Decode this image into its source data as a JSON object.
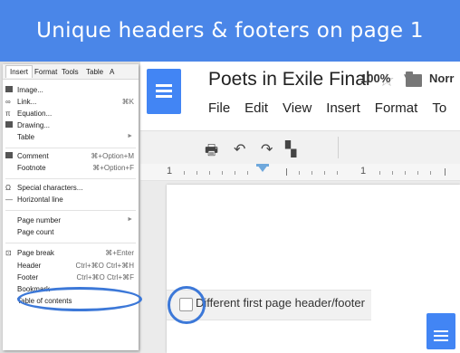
{
  "banner": {
    "title": "Unique headers & footers on page 1"
  },
  "docs": {
    "title": "Poets in Exile Final",
    "menubar": [
      "File",
      "Edit",
      "View",
      "Insert",
      "Format",
      "To"
    ],
    "toolbar": {
      "zoom": "100%",
      "font": "Norr"
    },
    "ruler": {
      "labels": [
        "1",
        "1"
      ]
    },
    "page": {
      "header_option_label": "Different first page header/footer"
    }
  },
  "menu": {
    "tabs": [
      "Insert",
      "Format",
      "Tools",
      "Table",
      "A"
    ],
    "items": [
      {
        "label": "Image...",
        "shortcut": "",
        "icon": "image-icon"
      },
      {
        "label": "Link...",
        "shortcut": "⌘K",
        "icon": "link-icon"
      },
      {
        "label": "Equation...",
        "shortcut": "",
        "icon": "pi-icon"
      },
      {
        "label": "Drawing...",
        "shortcut": "",
        "icon": "drawing-icon"
      },
      {
        "label": "Table",
        "shortcut": "",
        "icon": ""
      },
      {
        "label": "Comment",
        "shortcut": "⌘+Option+M",
        "icon": "comment-icon"
      },
      {
        "label": "Footnote",
        "shortcut": "⌘+Option+F",
        "icon": ""
      },
      {
        "label": "Special characters...",
        "shortcut": "",
        "icon": "omega-icon"
      },
      {
        "label": "Horizontal line",
        "shortcut": "",
        "icon": "hr-icon"
      },
      {
        "label": "Page number",
        "shortcut": "",
        "icon": ""
      },
      {
        "label": "Page count",
        "shortcut": "",
        "icon": ""
      },
      {
        "label": "Page break",
        "shortcut": "⌘+Enter",
        "icon": "page-break-icon"
      },
      {
        "label": "Header",
        "shortcut": "Ctrl+⌘O Ctrl+⌘H",
        "icon": ""
      },
      {
        "label": "Footer",
        "shortcut": "Ctrl+⌘O Ctrl+⌘F",
        "icon": ""
      },
      {
        "label": "Bookmark",
        "shortcut": "",
        "icon": ""
      },
      {
        "label": "Table of contents",
        "shortcut": "",
        "icon": ""
      }
    ]
  },
  "colors": {
    "banner": "#4a86e8",
    "docs_blue": "#4285f4",
    "annotation": "#3c78d8"
  }
}
